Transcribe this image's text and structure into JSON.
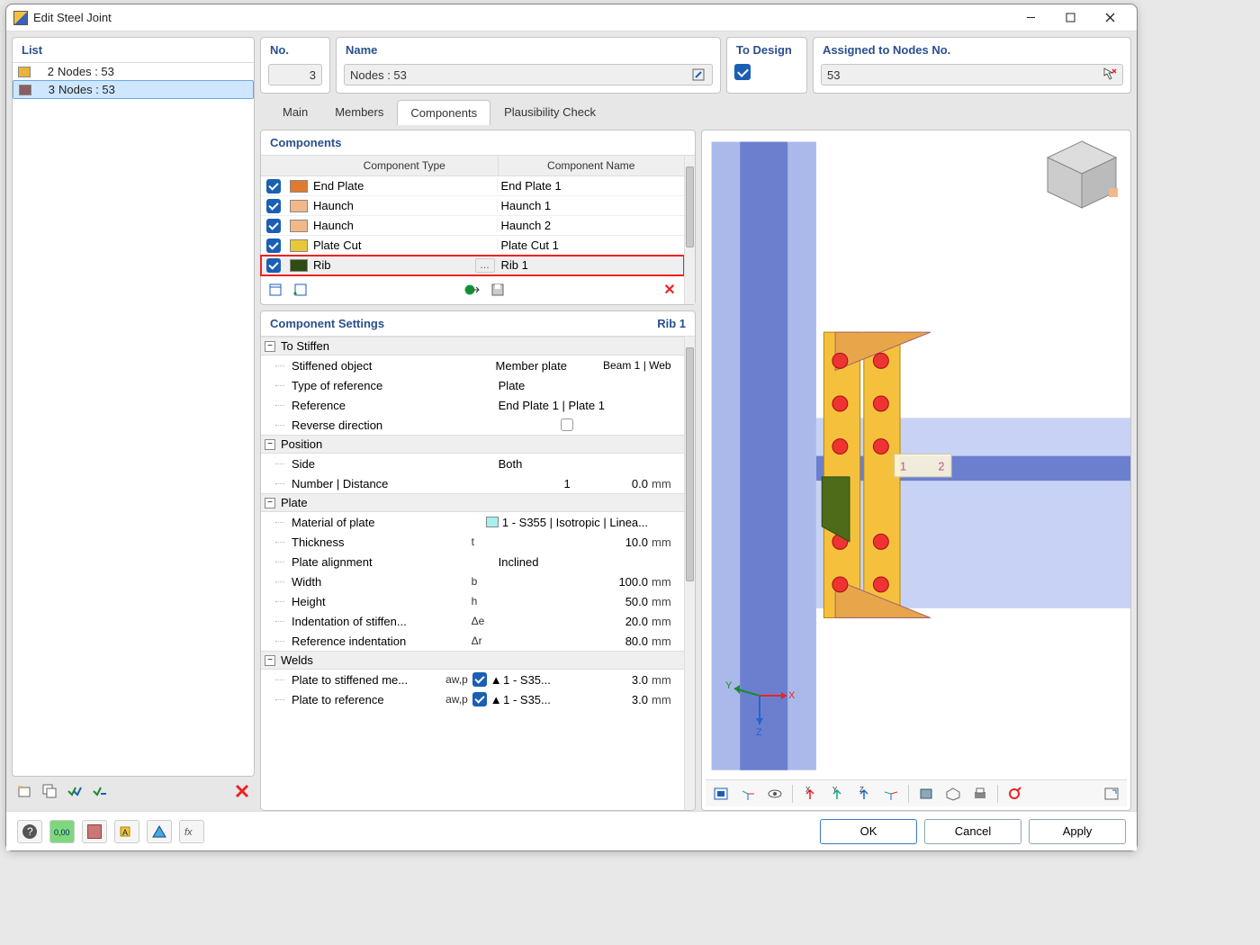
{
  "window": {
    "title": "Edit Steel Joint"
  },
  "list": {
    "header": "List",
    "items": [
      {
        "idx": "2",
        "label": "Nodes : 53",
        "color": "#e8b43a",
        "selected": false
      },
      {
        "idx": "3",
        "label": "Nodes : 53",
        "color": "#8a5f62",
        "selected": true
      }
    ]
  },
  "header": {
    "no_label": "No.",
    "no_value": "3",
    "name_label": "Name",
    "name_value": "Nodes : 53",
    "design_label": "To Design",
    "nodes_label": "Assigned to Nodes No.",
    "nodes_value": "53"
  },
  "tabs": [
    "Main",
    "Members",
    "Components",
    "Plausibility Check"
  ],
  "active_tab": 2,
  "components": {
    "header": "Components",
    "col_type": "Component Type",
    "col_name": "Component Name",
    "rows": [
      {
        "checked": true,
        "color": "#e07a2f",
        "type": "End Plate",
        "name": "End Plate 1",
        "hl": false
      },
      {
        "checked": true,
        "color": "#f2b88a",
        "type": "Haunch",
        "name": "Haunch 1",
        "hl": false
      },
      {
        "checked": true,
        "color": "#f2b88a",
        "type": "Haunch",
        "name": "Haunch 2",
        "hl": false
      },
      {
        "checked": true,
        "color": "#e8c83a",
        "type": "Plate Cut",
        "name": "Plate Cut 1",
        "hl": false
      },
      {
        "checked": true,
        "color": "#2f4d12",
        "type": "Rib",
        "name": "Rib 1",
        "hl": true
      }
    ]
  },
  "settings": {
    "header": "Component Settings",
    "current": "Rib 1",
    "groups": [
      {
        "name": "To Stiffen",
        "rows": [
          {
            "name": "Stiffened object",
            "val": "Member plate",
            "extra": "Beam 1 | Web"
          },
          {
            "name": "Type of reference",
            "val": "Plate",
            "left": true
          },
          {
            "name": "Reference",
            "val": "End Plate 1 | Plate 1",
            "left": true
          },
          {
            "name": "Reverse direction",
            "chk": true
          }
        ]
      },
      {
        "name": "Position",
        "rows": [
          {
            "name": "Side",
            "val": "Both",
            "left": true
          },
          {
            "name": "Number | Distance",
            "val": "1",
            "val2": "0.0",
            "unit": "mm"
          }
        ]
      },
      {
        "name": "Plate",
        "rows": [
          {
            "name": "Material of plate",
            "mat": true,
            "val": "1 - S355 | Isotropic | Linea..."
          },
          {
            "name": "Thickness",
            "sym": "t",
            "val": "10.0",
            "unit": "mm"
          },
          {
            "name": "Plate alignment",
            "val": "Inclined",
            "left": true
          },
          {
            "name": "Width",
            "sym": "b",
            "val": "100.0",
            "unit": "mm"
          },
          {
            "name": "Height",
            "sym": "h",
            "val": "50.0",
            "unit": "mm"
          },
          {
            "name": "Indentation of stiffen...",
            "sym": "Δe",
            "val": "20.0",
            "unit": "mm"
          },
          {
            "name": "Reference indentation",
            "sym": "Δr",
            "val": "80.0",
            "unit": "mm"
          }
        ]
      },
      {
        "name": "Welds",
        "rows": [
          {
            "name": "Plate to stiffened me...",
            "sym": "aw,p",
            "weld": true,
            "val": "1 - S35...",
            "val2": "3.0",
            "unit": "mm"
          },
          {
            "name": "Plate to reference",
            "sym": "aw,p",
            "weld": true,
            "val": "1 - S35...",
            "val2": "3.0",
            "unit": "mm"
          }
        ]
      }
    ]
  },
  "axes": {
    "x": "X",
    "y": "Y",
    "z": "Z"
  },
  "footer": {
    "ok": "OK",
    "cancel": "Cancel",
    "apply": "Apply"
  }
}
